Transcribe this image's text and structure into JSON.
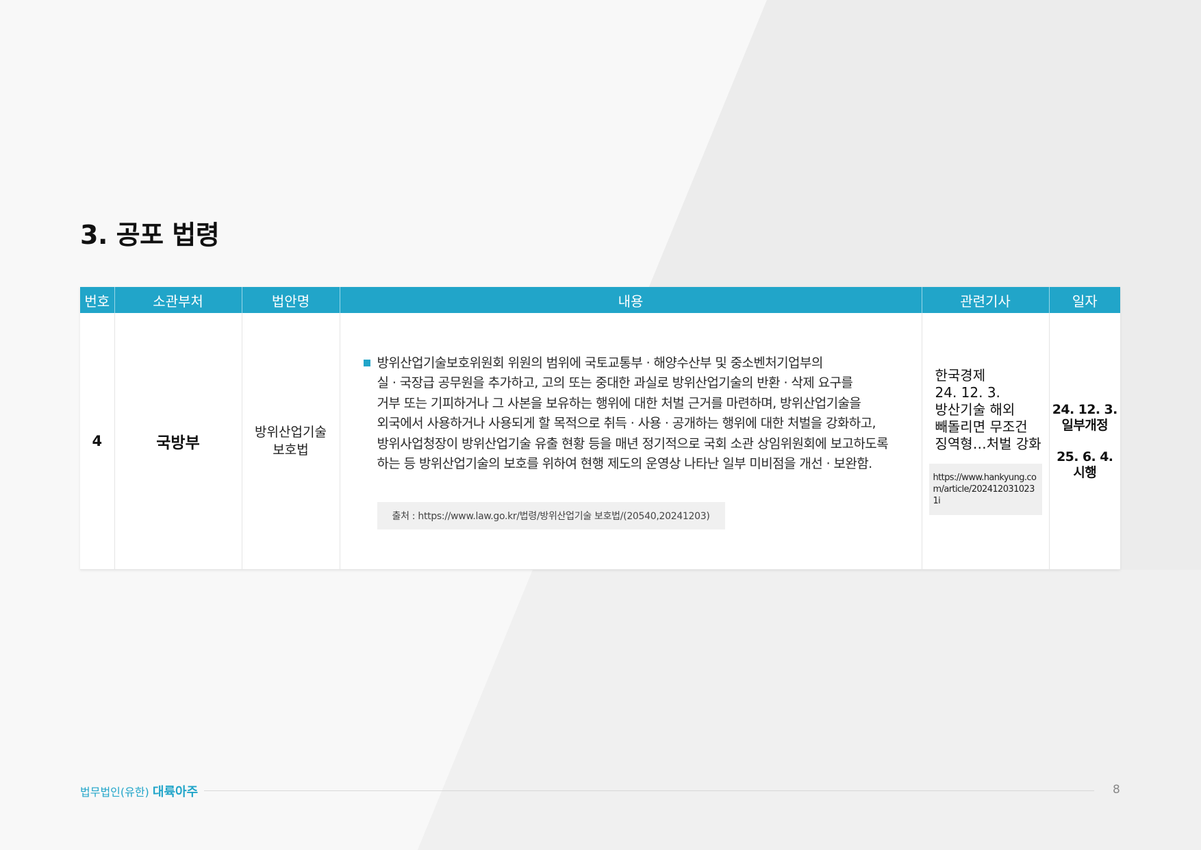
{
  "section": {
    "title": "3. 공포 법령"
  },
  "table": {
    "headers": [
      "번호",
      "소관부처",
      "법안명",
      "내용",
      "관련기사",
      "일자"
    ],
    "row": {
      "number": "4",
      "ministry": "국방부",
      "law_name_lines": [
        "방위산업기술",
        "보호법"
      ],
      "content_lines": [
        "방위산업기술보호위원회 위원의 범위에 국토교통부 · 해양수산부 및 중소벤처기업부의",
        "실 · 국장급 공무원을 추가하고, 고의 또는 중대한 과실로 방위산업기술의 반환 · 삭제 요구를",
        "거부 또는 기피하거나 그 사본을 보유하는 행위에 대한 처벌 근거를 마련하며, 방위산업기술을",
        "외국에서 사용하거나 사용되게 할 목적으로 취득 · 사용 · 공개하는 행위에 대한 처벌을 강화하고,",
        "방위사업청장이 방위산업기술 유출 현황 등을 매년 정기적으로 국회 소관 상임위원회에 보고하도록",
        "하는 등 방위산업기술의 보호를 위하여 현행 제도의 운영상 나타난 일부 미비점을 개선 · 보완함."
      ],
      "source": "출처 : https://www.law.go.kr/법령/방위산업기술 보호법/(20540,20241203)",
      "article_lines": [
        "한국경제",
        "24. 12. 3.",
        "방산기술 해외",
        "빼돌리면 무조건",
        "징역형…처벌 강화"
      ],
      "article_url": "https://www.hankyung.com/article/2024120310231i",
      "date_amended": "24. 12. 3.",
      "date_amended_label": "일부개정",
      "date_effective": "25. 6. 4.",
      "date_effective_label": "시행"
    }
  },
  "footer": {
    "brand_prefix": "법무법인(유한)",
    "brand_name": "대륙아주",
    "page_number": "8"
  },
  "colors": {
    "accent": "#21a5c9",
    "header_text": "#ffffff",
    "background": "#f2f2f2"
  }
}
